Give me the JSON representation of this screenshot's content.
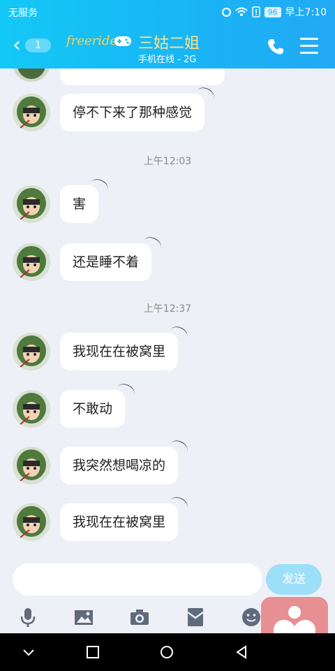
{
  "status_bar": {
    "carrier": "无服务",
    "battery": "96",
    "time": "早上7:10"
  },
  "title_bar": {
    "unread_count": "1",
    "logo_text": "freeride",
    "contact_name": "三姑二姐",
    "contact_status": "手机在线 - 2G"
  },
  "messages": [
    {
      "text": "停不下来了那种感觉"
    },
    {
      "text": "害"
    },
    {
      "text": "还是睡不着"
    },
    {
      "text": "我现在在被窝里"
    },
    {
      "text": "不敢动"
    },
    {
      "text": "我突然想喝凉的"
    },
    {
      "text": "我现在在被窝里"
    }
  ],
  "timestamps": [
    "上午12:03",
    "上午12:37"
  ],
  "input": {
    "placeholder": "",
    "send_label": "发送"
  },
  "toolbar": {
    "icons": [
      "microphone-icon",
      "image-icon",
      "camera-icon",
      "red-packet-icon",
      "emoji-icon"
    ]
  },
  "colors": {
    "header": "#18b7f5",
    "contact_name": "#ffe28a",
    "send_button": "#9ddff7",
    "floating_app": "#e88f93"
  }
}
